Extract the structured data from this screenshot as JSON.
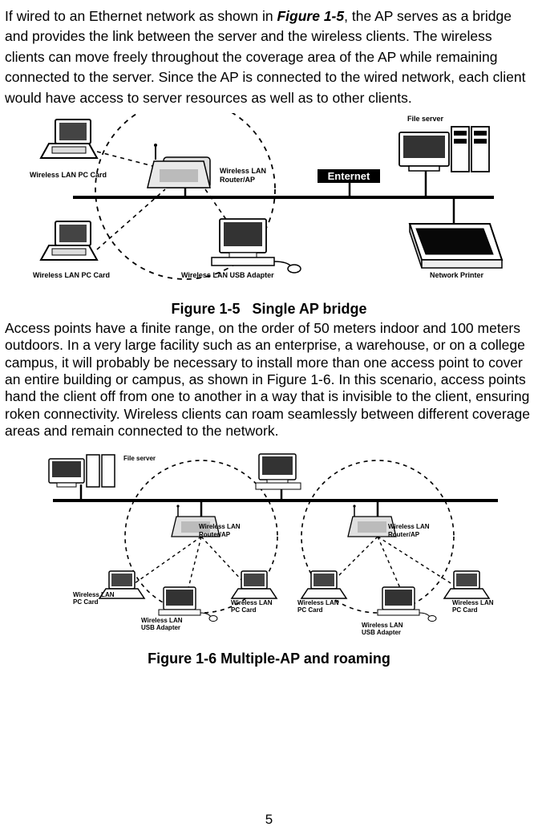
{
  "intro": {
    "before_ref": "If wired to an Ethernet network as shown in ",
    "ref": "Figure 1-5",
    "after_ref": ", the AP serves as a bridge and provides the link between the server and the wireless clients. The wireless clients can move freely throughout the coverage area of the AP while remaining connected to the server. Since the AP is connected to the wired network, each client would have access to server resources as well as to other clients."
  },
  "figure1": {
    "caption": "Figure 1-5   Single AP bridge",
    "labels": {
      "wlan_pc_card_top": "Wireless LAN PC Card",
      "wlan_router_ap": "Wireless LAN",
      "wlan_router_ap2": "Router/AP",
      "enternet": "Enternet",
      "file_server": "File server",
      "wlan_pc_card_bottom": "Wireless LAN PC Card",
      "wlan_usb_adapter": "Wireless LAN USB Adapter",
      "network_printer": "Network Printer"
    }
  },
  "mid_para": "Access points have a finite range, on the order of 50 meters indoor and 100 meters outdoors. In a very large facility such as an enterprise, a warehouse, or on a college campus, it will probably be necessary to install more than one access point to cover an entire building or campus, as shown in Figure 1-6. In this scenario, access points hand the client off from one to another in a way that is invisible to the client, ensuring roken connectivity. Wireless clients can roam seamlessly between different coverage areas and remain connected to the network.",
  "figure2": {
    "caption": "Figure 1-6 Multiple-AP and roaming",
    "labels": {
      "file_server": "File server",
      "wlan_router_ap": "Wireless LAN",
      "wlan_router_ap2": "Router/AP",
      "wlan_pc_card": "Wireless LAN",
      "wlan_pc_card2": "PC Card",
      "wlan_usb_adapter": "Wireless LAN",
      "wlan_usb_adapter2": "USB Adapter"
    }
  },
  "page_number": "5"
}
